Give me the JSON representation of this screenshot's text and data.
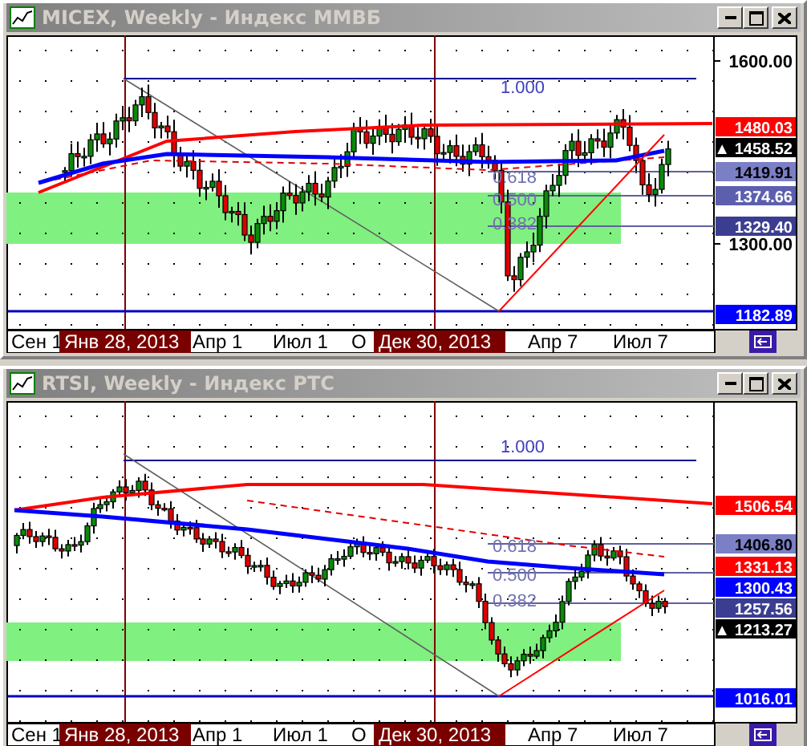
{
  "windows": [
    {
      "title": "MICEX, Weekly - Индекс ММВБ",
      "price_axis": [
        "1600.00",
        "1300.00"
      ],
      "price_tags": [
        {
          "text": "1480.03",
          "color": "#ff0000"
        },
        {
          "text": "▲ 1458.52",
          "color": "#000000"
        },
        {
          "text": "1419.91",
          "color": "#7b7fc6"
        },
        {
          "text": "1374.66",
          "color": "#5c5fae"
        },
        {
          "text": "1329.40",
          "color": "#3b3e90"
        },
        {
          "text": "1182.89",
          "color": "#0000ff"
        }
      ],
      "fib_levels": [
        "1.000",
        "0.618",
        "0.500",
        "0.382"
      ],
      "date_axis": [
        {
          "text": "Сен 1",
          "kind": "tick"
        },
        {
          "text": "Янв 28, 2013",
          "kind": "marker"
        },
        {
          "text": "Апр 1",
          "kind": "tick"
        },
        {
          "text": "Июл 1",
          "kind": "tick"
        },
        {
          "text": "О",
          "kind": "tick"
        },
        {
          "text": "Дек 30, 2013",
          "kind": "marker"
        },
        {
          "text": "Апр 7",
          "kind": "tick"
        },
        {
          "text": "Июл 7",
          "kind": "tick"
        }
      ]
    },
    {
      "title": "RTSI, Weekly - Индекс РТС",
      "price_tags": [
        {
          "text": "1506.54",
          "color": "#ff0000"
        },
        {
          "text": "1406.80",
          "color": "#7b7fc6"
        },
        {
          "text": "1331.13",
          "color": "#ff0000"
        },
        {
          "text": "1300.43",
          "color": "#0000ff"
        },
        {
          "text": "1257.56",
          "color": "#3b3e90"
        },
        {
          "text": "▲ 1213.27",
          "color": "#000000"
        },
        {
          "text": "1016.01",
          "color": "#0000ff"
        }
      ],
      "fib_levels": [
        "1.000",
        "0.618",
        "0.500",
        "0.382"
      ],
      "date_axis": [
        {
          "text": "Сен 1",
          "kind": "tick"
        },
        {
          "text": "Янв 28, 2013",
          "kind": "marker"
        },
        {
          "text": "Апр 1",
          "kind": "tick"
        },
        {
          "text": "Июл 1",
          "kind": "tick"
        },
        {
          "text": "О",
          "kind": "tick"
        },
        {
          "text": "Дек 30, 2013",
          "kind": "marker"
        },
        {
          "text": "Апр 7",
          "kind": "tick"
        },
        {
          "text": "Июл 7",
          "kind": "tick"
        }
      ]
    }
  ]
}
